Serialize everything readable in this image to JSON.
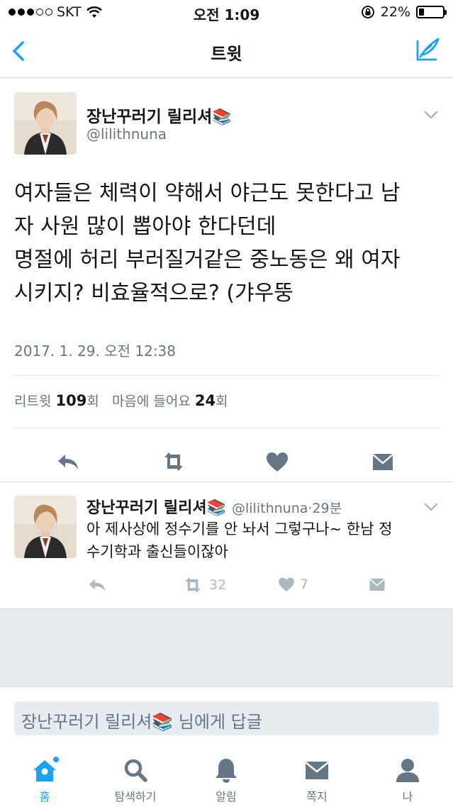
{
  "status_bar": {
    "carrier": "SKT",
    "time": "오전 1:09",
    "battery": "22%",
    "battery_level": 0.22
  },
  "nav": {
    "title": "트윗",
    "back_icon": "chevron-left-icon",
    "compose_icon": "compose-tweet-icon"
  },
  "main_tweet": {
    "author_name": "장난꾸러기 릴리셔",
    "author_emoji": "📚",
    "handle": "@lilithnuna",
    "text": "여자들은 체력이 약해서 야근도 못한다고 남\n자 사원 많이 뽑아야 한다던데\n명절에 허리 부러질거같은 중노동은 왜 여자\n시키지? 비효율적으로? (갸우뚱",
    "date": "2017. 1. 29. 오전 12:38",
    "retweet_label": "리트윗",
    "retweet_count": "109",
    "count_unit": "회",
    "like_label": "마음에 들어요",
    "like_count": "24"
  },
  "reply": {
    "author_name": "장난꾸러기 릴리셔",
    "author_emoji": "📚",
    "handle": "@lilithnuna",
    "separator": "·",
    "time_ago": "29분",
    "text": "아 제사상에 정수기를 안 놔서 그렇구나~ 한남 정\n수기학과 출신들이잖아",
    "retweets": "32",
    "likes": "7"
  },
  "reply_box": {
    "placeholder": "장난꾸러기 릴리셔📚 님에게 답글"
  },
  "tabs": [
    {
      "label": "홈",
      "icon": "home-icon",
      "active": true
    },
    {
      "label": "탐색하기",
      "icon": "search-icon",
      "active": false
    },
    {
      "label": "알림",
      "icon": "bell-icon",
      "active": false
    },
    {
      "label": "쪽지",
      "icon": "envelope-icon",
      "active": false
    },
    {
      "label": "나",
      "icon": "profile-icon",
      "active": false
    }
  ],
  "colors": {
    "accent": "#1da1f2",
    "icon_dark": "#657786",
    "icon_light": "#aab8c2",
    "text": "#14171a",
    "muted": "#657786"
  }
}
